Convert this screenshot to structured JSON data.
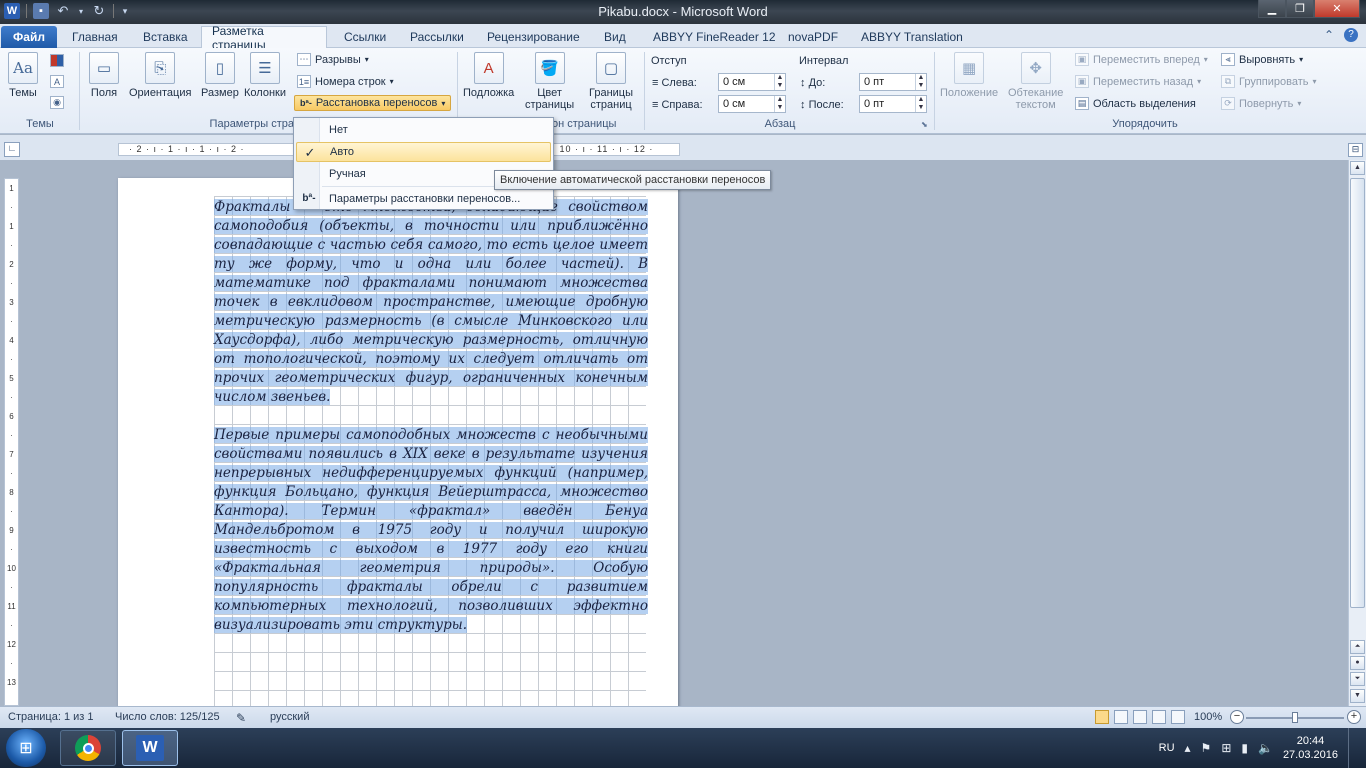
{
  "window": {
    "title": "Pikabu.docx - Microsoft Word"
  },
  "tabs": [
    {
      "label": "Файл"
    },
    {
      "label": "Главная"
    },
    {
      "label": "Вставка"
    },
    {
      "label": "Разметка страницы"
    },
    {
      "label": "Ссылки"
    },
    {
      "label": "Рассылки"
    },
    {
      "label": "Рецензирование"
    },
    {
      "label": "Вид"
    },
    {
      "label": "ABBYY FineReader 12"
    },
    {
      "label": "novaPDF"
    },
    {
      "label": "ABBYY Translation"
    }
  ],
  "ribbon": {
    "themes": {
      "label": "Темы",
      "group": "Темы"
    },
    "page_setup": {
      "group": "Параметры страницы",
      "fields": "Поля",
      "orientation": "Ориентация",
      "size": "Размер",
      "columns": "Колонки",
      "breaks": "Разрывы",
      "line_numbers": "Номера строк",
      "hyphenation": "Расстановка переносов"
    },
    "page_background": {
      "group": "Фон страницы",
      "watermark": "Подложка",
      "page_color_1": "Цвет",
      "page_color_2": "страницы",
      "borders_1": "Границы",
      "borders_2": "страниц"
    },
    "paragraph": {
      "group": "Абзац",
      "indent": "Отступ",
      "left_label": "Слева:",
      "left_value": "0 см",
      "right_label": "Справа:",
      "right_value": "0 см",
      "spacing": "Интервал",
      "before_label": "До:",
      "before_value": "0 пт",
      "after_label": "После:",
      "after_value": "0 пт"
    },
    "arrange": {
      "group": "Упорядочить",
      "position": "Положение",
      "wrap_1": "Обтекание",
      "wrap_2": "текстом",
      "bring_forward": "Переместить вперед",
      "send_backward": "Переместить назад",
      "selection_pane": "Область выделения",
      "align": "Выровнять",
      "group_btn": "Группировать",
      "rotate": "Повернуть"
    }
  },
  "hyphen_menu": {
    "items": [
      {
        "label": "Нет"
      },
      {
        "label": "Авто"
      },
      {
        "label": "Ручная"
      },
      {
        "label": "Параметры расстановки переносов..."
      }
    ],
    "tooltip": "Включение автоматической расстановки переносов"
  },
  "ruler": {
    "h_text": "· 2 · ı · 1 · ı · 1 · ı · 2 ·",
    "h_text_right": "· ı · 10 · ı · 11 · ı · 12 ·",
    "v_marks": [
      "1",
      "·",
      "1",
      "·",
      "2",
      "·",
      "3",
      "·",
      "4",
      "·",
      "5",
      "·",
      "6",
      "·",
      "7",
      "·",
      "8",
      "·",
      "9",
      "·",
      "10",
      "·",
      "11",
      "·",
      "12",
      "·",
      "13"
    ]
  },
  "document": {
    "paragraph1": "Фракталы — это множества, обладающие свойством самоподобия (объекты, в точности или приближённо совпадающие с частью себя самого, то есть целое имеет ту же форму, что и одна или более частей). В математике под фракталами понимают множества точек в евклидовом пространстве, имеющие дробную метрическую размерность (в смысле Минковского или Хаусдорфа), либо метрическую размерность, отличную от топологической, поэтому их следует отличать от прочих геометрических фигур, ограниченных конечным числом звеньев.",
    "paragraph2": "Первые примеры самоподобных множеств с необычными свойствами появились в XIX веке в результате изучения непрерывных недифференцируемых функций (например, функция Больцано, функция Вейерштрасса, множество Кантора). Термин «фрактал» введён Бенуа Мандельбротом в 1975 году и получил широкую известность с выходом в 1977 году его книги «Фрактальная геометрия природы». Особую популярность фракталы обрели с развитием компьютерных технологий, позволивших эффектно визуализировать эти структуры."
  },
  "status": {
    "page": "Страница: 1 из 1",
    "words": "Число слов: 125/125",
    "language": "русский",
    "zoom": "100%"
  },
  "taskbar": {
    "lang": "RU",
    "time": "20:44",
    "date": "27.03.2016"
  }
}
